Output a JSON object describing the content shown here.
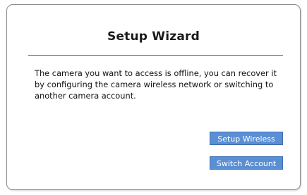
{
  "dialog": {
    "title": "Setup Wizard",
    "message": "The camera you want to access is offline, you can recover it by configuring the camera wireless network or switching to another camera account.",
    "buttons": {
      "setup_wireless": "Setup Wireless",
      "switch_account": "Switch Account"
    }
  },
  "colors": {
    "button_bg": "#5b8fd4",
    "button_border": "#3f6fb0",
    "button_text": "#ffffff",
    "frame_border": "#8c8c8c"
  }
}
